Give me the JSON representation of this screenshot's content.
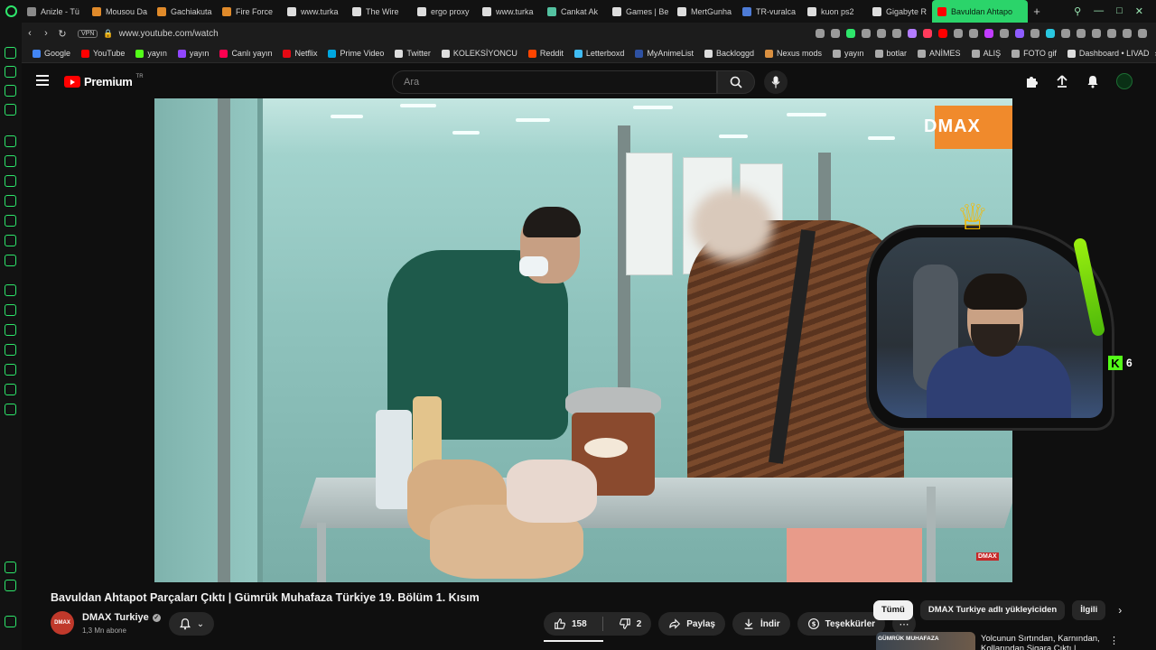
{
  "browser": {
    "tabs": [
      {
        "label": "Anizle - Tü",
        "color": "#8a8a8a"
      },
      {
        "label": "Mousou Da",
        "color": "#e08a2a"
      },
      {
        "label": "Gachiakuta",
        "color": "#e08a2a"
      },
      {
        "label": "Fire Force",
        "color": "#e08a2a"
      },
      {
        "label": "www.turka",
        "color": "#dddddd"
      },
      {
        "label": "The Wire",
        "color": "#dddddd"
      },
      {
        "label": "ergo proxy",
        "color": "#dddddd"
      },
      {
        "label": "www.turka",
        "color": "#dddddd"
      },
      {
        "label": "Cankat Ak",
        "color": "#53c1a0"
      },
      {
        "label": "Games | Be",
        "color": "#dddddd"
      },
      {
        "label": "MertGunha",
        "color": "#dddddd"
      },
      {
        "label": "TR-vuralca",
        "color": "#4d7bd6"
      },
      {
        "label": "kuon ps2",
        "color": "#dddddd"
      },
      {
        "label": "Gigabyte R",
        "color": "#dddddd"
      }
    ],
    "active_tab": "Bavuldan Ahtapo",
    "new_tab": "+",
    "url": "www.youtube.com/watch",
    "vpn": "VPN",
    "bookmarks": [
      {
        "label": "Google",
        "color": "#4285f4"
      },
      {
        "label": "YouTube",
        "color": "#ff0000"
      },
      {
        "label": "yayın",
        "color": "#53fc18"
      },
      {
        "label": "yayın",
        "color": "#9146ff"
      },
      {
        "label": "Canlı yayın",
        "color": "#ff0050"
      },
      {
        "label": "Netflix",
        "color": "#e50914"
      },
      {
        "label": "Prime Video",
        "color": "#00a8e1"
      },
      {
        "label": "Twitter",
        "color": "#dddddd"
      },
      {
        "label": "KOLEKSİYONCU",
        "color": "#dddddd"
      },
      {
        "label": "Reddit",
        "color": "#ff4500"
      },
      {
        "label": "Letterboxd",
        "color": "#40bcf4"
      },
      {
        "label": "MyAnimeList",
        "color": "#2e51a2"
      },
      {
        "label": "Backloggd",
        "color": "#dddddd"
      },
      {
        "label": "Nexus mods",
        "color": "#d98f40"
      },
      {
        "label": "yayın",
        "color": "#aaaaaa"
      },
      {
        "label": "botlar",
        "color": "#aaaaaa"
      },
      {
        "label": "ANİMES",
        "color": "#aaaaaa"
      },
      {
        "label": "ALIŞ",
        "color": "#aaaaaa"
      },
      {
        "label": "FOTO gif",
        "color": "#aaaaaa"
      },
      {
        "label": "Dashboard • LIVAD",
        "color": "#dddddd"
      }
    ]
  },
  "youtube": {
    "logo_text": "Premium",
    "country": "TR",
    "search_placeholder": "Ara",
    "video": {
      "watermark": "DMAX",
      "watermark_small": "DMAX",
      "title": "Bavuldan Ahtapot Parçaları Çıktı | Gümrük Muhafaza Türkiye 19. Bölüm 1. Kısım",
      "channel_avatar_text": "DMAX",
      "channel_name": "DMAX Turkiye",
      "subscribers": "1,3 Mn abone",
      "likes": "158",
      "dislikes": "2",
      "share": "Paylaş",
      "download": "İndir",
      "thanks": "Teşekkürler"
    },
    "chips": [
      "Tümü",
      "DMAX Turkiye adlı yükleyiciden",
      "İlgili"
    ],
    "recommendation": {
      "thumb_text": "GÜMRÜK MUHAFAZA",
      "title": "Yolcunun Sırtından, Karnından, Kollarından Sigara Çıktı |"
    }
  },
  "stream_overlay": {
    "kick_letter": "K",
    "viewer_count": "6"
  }
}
